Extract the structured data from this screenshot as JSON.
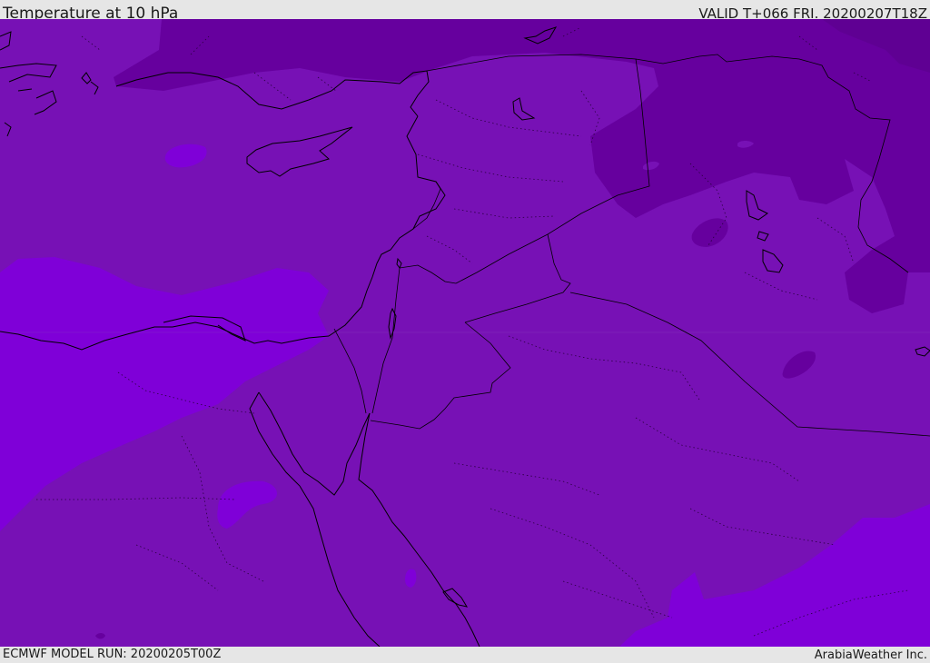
{
  "header": {
    "title": "Temperature at 10 hPa",
    "valid": "VALID T+066 FRI. 20200207T18Z"
  },
  "footer": {
    "model_run": "ECMWF MODEL RUN: 20200205T00Z",
    "credit": "ArabiaWeather Inc."
  },
  "colors": {
    "base": "#7711b5",
    "cold_dark": "#66009e",
    "warm_bright": "#7f00d8",
    "coastline": "#000000"
  }
}
